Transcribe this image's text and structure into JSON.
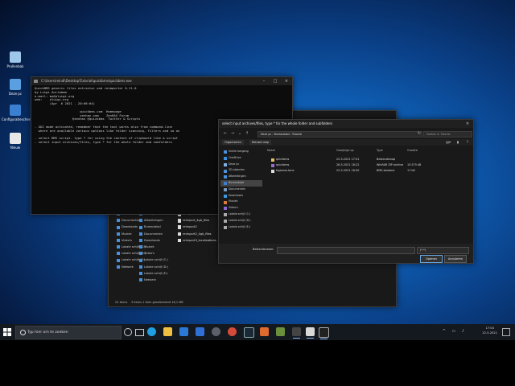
{
  "desktop": {
    "icons": [
      {
        "label": "Prullenbak",
        "icon": "recycle-bin-icon"
      },
      {
        "label": "Deze pc",
        "icon": "this-pc-icon"
      },
      {
        "label": "Configuratiescherm",
        "icon": "control-panel-icon"
      },
      {
        "label": "Nieuw",
        "icon": "text-file-icon"
      }
    ]
  },
  "console": {
    "title": "C:\\Users\\reindl\\Desktop\\Tutorial\\quickbms\\quickbms.exe",
    "lines": [
      "QuickBMS generic files extractor and reimporter 0.11.0",
      "by Luigi Auriemma",
      "e-mail: me@aluigi.org",
      "web:    aluigi.org",
      "        (Apr  6 2021 - 20:06:04)",
      "",
      "                        quickbms.com  Homepage",
      "                        zenhax.com    ZenHAX Forum",
      "                    @zenhax @quickbms  Twitter & Scripts",
      "",
      "- GUI mode activated, remember that the tool works also from command-line",
      "  where are available various options like folder scanning, filters and so on",
      "",
      "- select BMS script. type ? for using the content of clipboard like a script",
      "- select input archives/files, type * for the whole folder and subfolders"
    ]
  },
  "background_explorer": {
    "nav_items": [
      "Bureaublad",
      "Documenten",
      "Downloads",
      "Muziek",
      "Video's",
      "Lokale schijf (C:)",
      "Lokale schijf (D:)",
      "Lokale schijf (E:)",
      "Netwerk"
    ],
    "nav_items_2": [
      "3D-objecten",
      "Afbeeldingen",
      "Bureaublad",
      "Documenten",
      "Downloads",
      "Muziek",
      "Video's",
      "Lokale schijf (C:)",
      "Lokale schijf (D:)",
      "Lokale schijf (E:)",
      "Netwerk"
    ],
    "files": [
      "reimport",
      "reimport_4gb_files",
      "reimport2",
      "reimport2_4gb_files",
      "reimport3_localizations"
    ],
    "status_left": "22 items",
    "status_right": "3 items   1 item geselecteerd  16,1 MB"
  },
  "dialog": {
    "title": "select input archives/files, type * for the whole folder and subfolders",
    "breadcrumb": [
      "Deze pc",
      "Bureaublad",
      "Tutorial"
    ],
    "search_placeholder": "Zoeken in Tutorial",
    "toolbar": {
      "organize": "Organiseren",
      "new_folder": "Nieuwe map"
    },
    "nav": [
      {
        "label": "Snelle toegang",
        "sel": false
      },
      {
        "label": "OneDrive",
        "sel": false
      },
      {
        "label": "Deze pc",
        "sel": false
      },
      {
        "label": "3D-objecten",
        "sel": false
      },
      {
        "label": "Afbeeldingen",
        "sel": false
      },
      {
        "label": "Bureaublad",
        "sel": true
      },
      {
        "label": "Documenten",
        "sel": false
      },
      {
        "label": "Downloads",
        "sel": false
      },
      {
        "label": "Muziek",
        "sel": false
      },
      {
        "label": "Video's",
        "sel": false
      },
      {
        "label": "Lokale schijf (C:)",
        "sel": false
      },
      {
        "label": "Lokale schijf (D:)",
        "sel": false
      },
      {
        "label": "Lokale schijf (E:)",
        "sel": false
      }
    ],
    "columns": {
      "name": "Naam",
      "date": "Gewijzigd op",
      "type": "Type",
      "size": "Grootte"
    },
    "files": [
      {
        "name": "quickbms",
        "date": "22-5-2021 17:01",
        "type": "Bestandsmap",
        "size": "",
        "color": "#e8c066"
      },
      {
        "name": "quickbms",
        "date": "28-5-2021 18:22",
        "type": "WinRAR ZIP archive",
        "size": "15.575 kB",
        "color": "#9a6bd0"
      },
      {
        "name": "ttgames.bms",
        "date": "22-5-2021 18:30",
        "type": "BMS-bestand",
        "size": "17 kB",
        "color": "#dddddd"
      }
    ],
    "filename_label": "Bestandsnaam:",
    "filetype": "(*.*)",
    "open_label": "Openen",
    "cancel_label": "Annuleren"
  },
  "taskbar": {
    "search_text": "Typ hier om te zoeken",
    "time": "17:04",
    "date": "22-5-2021"
  },
  "colors": {
    "accent": "#0f5fb5",
    "taskbar": "#14181f",
    "window": "#191919"
  }
}
